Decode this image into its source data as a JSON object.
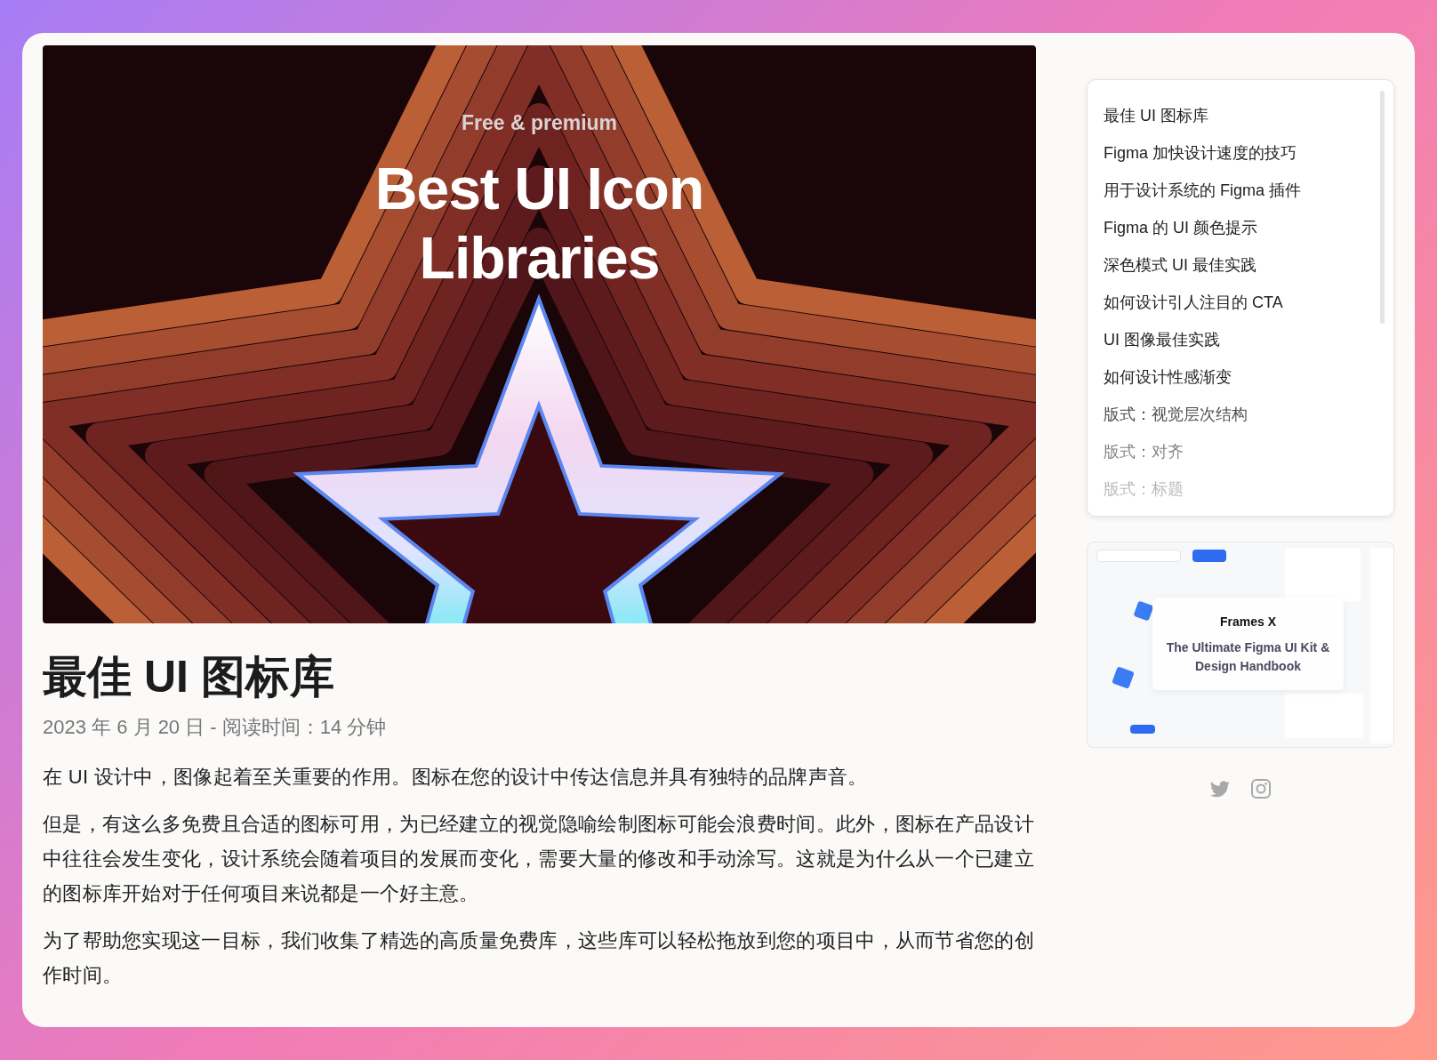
{
  "hero": {
    "kicker": "Free & premium",
    "title_lines": [
      "Best UI Icon",
      "Libraries"
    ]
  },
  "article": {
    "title": "最佳 UI 图标库",
    "meta": "2023 年 6 月 20 日 - 阅读时间：14 分钟",
    "paragraphs": [
      "在 UI 设计中，图像起着至关重要的作用。图标在您的设计中传达信息并具有独特的品牌声音。",
      "但是，有这么多免费且合适的图标可用，为已经建立的视觉隐喻绘制图标可能会浪费时间。此外，图标在产品设计中往往会发生变化，设计系统会随着项目的发展而变化，需要大量的修改和手动涂写。这就是为什么从一个已建立的图标库开始对于任何项目来说都是一个好主意。",
      "为了帮助您实现这一目标，我们收集了精选的高质量免费库，这些库可以轻松拖放到您的项目中，从而节省您的创作时间。"
    ]
  },
  "sidebar": {
    "items": [
      {
        "label": "最佳 UI 图标库"
      },
      {
        "label": "Figma 加快设计速度的技巧"
      },
      {
        "label": "用于设计系统的 Figma 插件"
      },
      {
        "label": "Figma 的 UI 颜色提示"
      },
      {
        "label": "深色模式 UI 最佳实践"
      },
      {
        "label": "如何设计引人注目的 CTA"
      },
      {
        "label": "UI 图像最佳实践"
      },
      {
        "label": "如何设计性感渐变"
      },
      {
        "label": "版式：视觉层次结构"
      },
      {
        "label": "版式：对齐"
      },
      {
        "label": "版式：标题"
      }
    ],
    "promo": {
      "brand": "Frames X",
      "headline": "The Ultimate Figma UI Kit & Design Handbook"
    },
    "social": [
      {
        "kind": "twitter"
      },
      {
        "kind": "instagram"
      }
    ]
  }
}
